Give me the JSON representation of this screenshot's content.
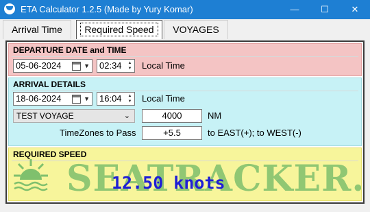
{
  "window": {
    "title": "ETA Calculator 1.2.5  (Made by Yury Komar)",
    "controls": {
      "minimize": "—",
      "maximize": "☐",
      "close": "✕"
    }
  },
  "tabs": [
    {
      "label": "Arrival Time",
      "active": false
    },
    {
      "label": "Required Speed",
      "active": true
    },
    {
      "label": "VOYAGES",
      "active": false
    }
  ],
  "departure": {
    "title": "DEPARTURE DATE and TIME",
    "date": "05-06-2024",
    "time": "02:34",
    "time_label": "Local Time"
  },
  "arrival": {
    "title": "ARRIVAL DETAILS",
    "date": "18-06-2024",
    "time": "16:04",
    "time_label": "Local Time",
    "voyage_selected": "TEST VOYAGE",
    "distance": "4000",
    "distance_unit": "NM",
    "timezones_label": "TimeZones to Pass",
    "timezones_value": "+5.5",
    "timezones_hint": "to EAST(+);  to WEST(-)"
  },
  "required": {
    "title": "REQUIRED SPEED",
    "speed_text": "12.50 knots",
    "watermark": "SEATRACKER.RU"
  },
  "colors": {
    "titlebar": "#1e7fd3",
    "departure_bg": "#f4c4c4",
    "arrival_bg": "#c7f2f6",
    "required_bg": "#f7f59b",
    "speed_text": "#1f1fd6",
    "watermark": "#7fc06d"
  },
  "icons": [
    "app-icon",
    "calendar-icon",
    "chevron-down-icon",
    "spin-arrows-icon",
    "sun-logo-icon"
  ]
}
